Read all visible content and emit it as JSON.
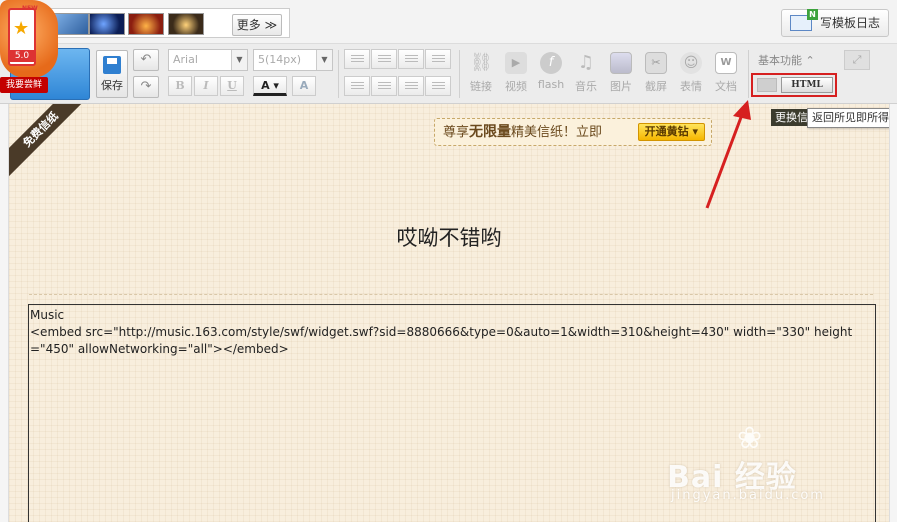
{
  "topbar": {
    "more_label": "更多 ≫",
    "write_template_label": "写模板日志"
  },
  "promo": {
    "version": "5.0",
    "new_badge": "NEW",
    "try_label": "我要尝鲜"
  },
  "toolbar": {
    "save_label": "保存",
    "font_family": "Arial",
    "font_size": "5(14px)",
    "format_buttons": [
      "B",
      "I",
      "U"
    ],
    "tools": [
      {
        "label": "链接",
        "icon": "link-icon"
      },
      {
        "label": "视频",
        "icon": "video-icon"
      },
      {
        "label": "flash",
        "icon": "flash-icon"
      },
      {
        "label": "音乐",
        "icon": "music-icon"
      },
      {
        "label": "图片",
        "icon": "picture-icon"
      },
      {
        "label": "截屏",
        "icon": "screenshot-icon"
      },
      {
        "label": "表情",
        "icon": "emoticon-icon"
      },
      {
        "label": "文档",
        "icon": "document-icon"
      }
    ],
    "basic_func_label": "基本功能 ⌃",
    "html_label": "HTML"
  },
  "editor": {
    "free_paper_label": "免费信纸",
    "vip_banner_prefix": "尊享",
    "vip_banner_bold": "无限量",
    "vip_banner_suffix": "精美信纸！立即",
    "vip_button": "开通黄钻",
    "change_paper_label": "更换信纸",
    "tooltip": "返回所见即所得",
    "post_title": "哎呦不错哟",
    "code_line1": "Music",
    "code_line2": "<embed src=\"http://music.163.com/style/swf/widget.swf?sid=8880666&type=0&auto=1&width=310&height=430\" width=\"330\" height=\"450\"  allowNetworking=\"all\"></embed>"
  },
  "watermark": {
    "main": "Bai 经验",
    "sub": "jingyan.baidu.com"
  },
  "colors": {
    "highlight_red": "#d62020",
    "paper_bg": "#f8eedd",
    "vip_yellow": "#f5b600"
  }
}
